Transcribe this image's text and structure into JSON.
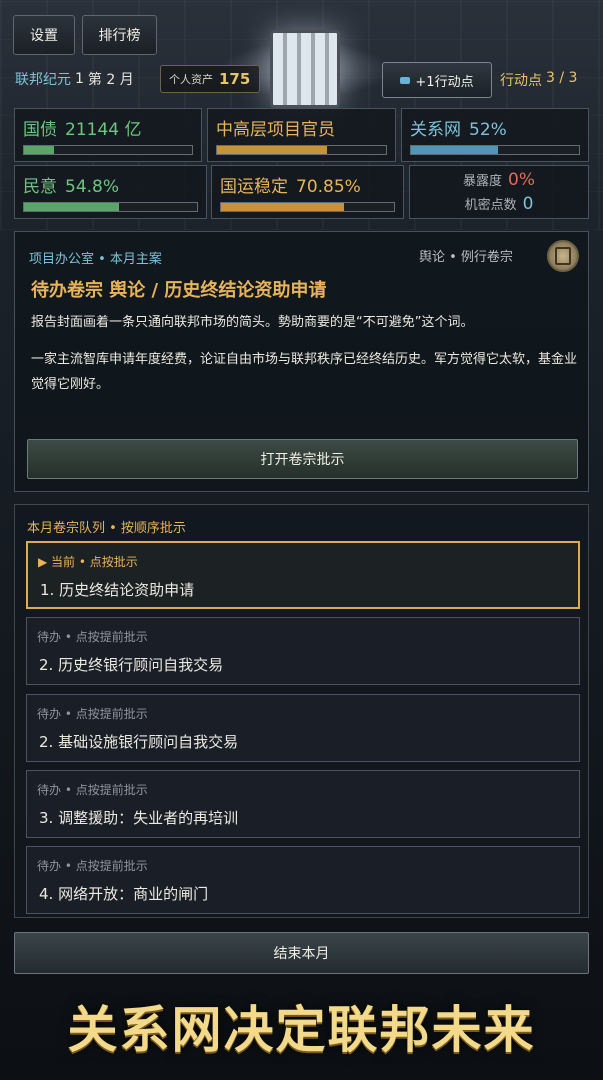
{
  "top": {
    "settings_label": "设置",
    "rank_label": "排行榜",
    "era_label": "联邦纪元",
    "era_year": "1",
    "month_label": "第 2 月",
    "assets_label": "个人资产",
    "assets_value": "175",
    "ap_button_label": "+1行动点",
    "ap_label": "行动点",
    "ap_value": "3 / 3"
  },
  "stats": {
    "debt": {
      "label": "国债",
      "value": "21144 亿",
      "fill": 0.18
    },
    "official": {
      "label": "中高层项目官员",
      "fill": 0.65
    },
    "network": {
      "label": "关系网",
      "value": "52%",
      "fill": 0.52
    },
    "will": {
      "label": "民意",
      "value": "54.8%",
      "fill": 0.548
    },
    "fortune": {
      "label": "国运稳定",
      "value": "70.85%",
      "fill": 0.7085
    },
    "exposure": {
      "label": "暴露度",
      "value": "0%"
    },
    "secret": {
      "label": "机密点数",
      "value": "0"
    }
  },
  "case": {
    "office": "项目办公室 • 本月主案",
    "tags": "舆论 • 例行卷宗",
    "title": "待办卷宗 舆论 / 历史终结论资助申请",
    "desc1": "报告封面画着一条只通向联邦市场的简头。勢助商要的是“不可避免”这个词。",
    "desc2": "一家主流智库申请年度经费，论证自由市场与联邦秩序已经终结历史。军方觉得它太软，基金业觉得它刚好。",
    "open_button": "打开卷宗批示"
  },
  "queue": {
    "header": "本月卷宗队列 • 按顺序批示",
    "items": [
      {
        "status": "▶ 当前 • 点按批示",
        "name": "1. 历史终结论资助申请"
      },
      {
        "status": "待办 • 点按提前批示",
        "name": "2. 历史终银行顾问自我交易"
      },
      {
        "status": "待办 • 点按提前批示",
        "name": "2. 基础设施银行顾问自我交易"
      },
      {
        "status": "待办 • 点按提前批示",
        "name": "3. 调整援助：失业者的再培训"
      },
      {
        "status": "待办 • 点按提前批示",
        "name": "4. 网络开放：商业的闸门"
      }
    ]
  },
  "end_button": "结束本月",
  "slogan": "关系网决定联邦未来",
  "colors": {
    "accent_gold": "#e8b35a",
    "accent_teal": "#7fc1d8",
    "green": "#6fc580",
    "red": "#e46a5a"
  }
}
